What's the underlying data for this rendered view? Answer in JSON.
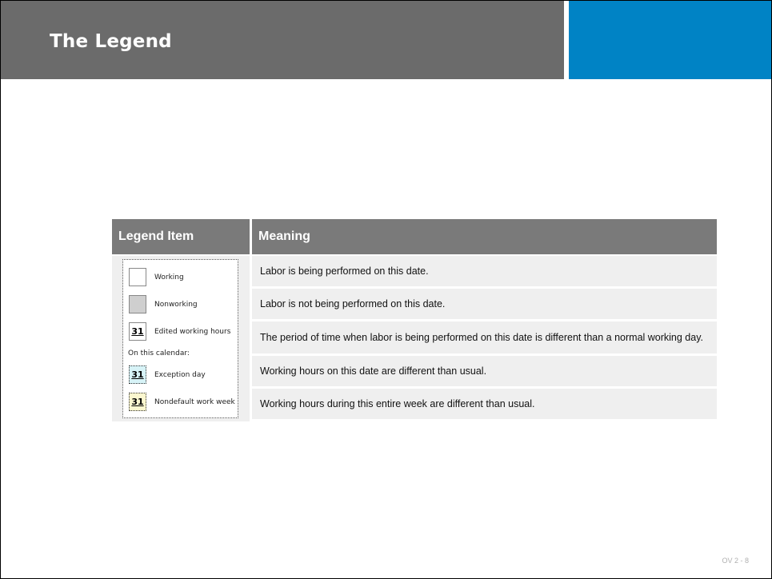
{
  "slide": {
    "title": "The Legend",
    "page_number": "OV 2 - 8",
    "colors": {
      "title_bar": "#6b6b6b",
      "accent": "#0083c5",
      "table_header": "#7a7a7a",
      "row_bg": "#efefef"
    }
  },
  "table": {
    "headers": [
      "Legend Item",
      "Meaning"
    ],
    "legend_items": [
      {
        "icon": "working-swatch-icon",
        "label": "Working"
      },
      {
        "icon": "nonworking-swatch-icon",
        "label": "Nonworking"
      },
      {
        "icon": "edited-working-hours-icon",
        "number": "31",
        "label": "Edited working hours"
      },
      {
        "icon": "exception-day-icon",
        "number": "31",
        "label": "Exception day"
      },
      {
        "icon": "nondefault-work-week-icon",
        "number": "31",
        "label": "Nondefault work week"
      }
    ],
    "on_this_calendar": "On this calendar:",
    "meanings": [
      "Labor is being performed on this date.",
      "Labor is not being performed on this date.",
      "The period of time when labor is being performed on this date is different than a normal working day.",
      "Working hours on this date are different than usual.",
      "Working hours during this entire week are different than usual."
    ]
  }
}
